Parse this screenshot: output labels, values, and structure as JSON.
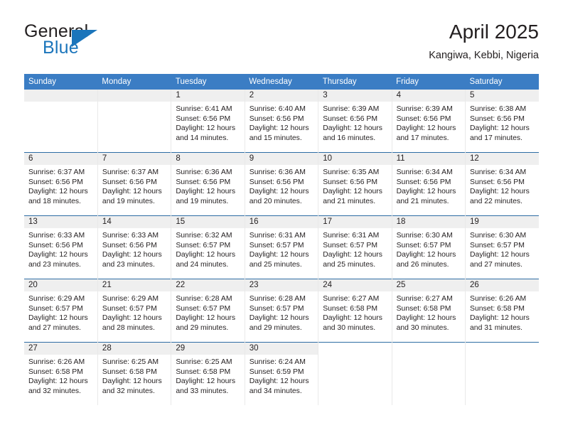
{
  "brand": {
    "name_part1": "General",
    "name_part2": "Blue",
    "logo_icon": "blue-triangle-icon"
  },
  "header": {
    "month_title": "April 2025",
    "location": "Kangiwa, Kebbi, Nigeria"
  },
  "colors": {
    "header_blue": "#3b7dc4",
    "row_divider_blue": "#2e6da4",
    "daynum_strip_grey": "#efefef",
    "brand_blue": "#1b75bb",
    "text": "#231f20"
  },
  "calendar": {
    "weekday_headers": [
      "Sunday",
      "Monday",
      "Tuesday",
      "Wednesday",
      "Thursday",
      "Friday",
      "Saturday"
    ],
    "weeks": [
      [
        {
          "day": "",
          "empty": true
        },
        {
          "day": "",
          "empty": true
        },
        {
          "day": "1",
          "sunrise": "Sunrise: 6:41 AM",
          "sunset": "Sunset: 6:56 PM",
          "daylight1": "Daylight: 12 hours",
          "daylight2": "and 14 minutes."
        },
        {
          "day": "2",
          "sunrise": "Sunrise: 6:40 AM",
          "sunset": "Sunset: 6:56 PM",
          "daylight1": "Daylight: 12 hours",
          "daylight2": "and 15 minutes."
        },
        {
          "day": "3",
          "sunrise": "Sunrise: 6:39 AM",
          "sunset": "Sunset: 6:56 PM",
          "daylight1": "Daylight: 12 hours",
          "daylight2": "and 16 minutes."
        },
        {
          "day": "4",
          "sunrise": "Sunrise: 6:39 AM",
          "sunset": "Sunset: 6:56 PM",
          "daylight1": "Daylight: 12 hours",
          "daylight2": "and 17 minutes."
        },
        {
          "day": "5",
          "sunrise": "Sunrise: 6:38 AM",
          "sunset": "Sunset: 6:56 PM",
          "daylight1": "Daylight: 12 hours",
          "daylight2": "and 17 minutes."
        }
      ],
      [
        {
          "day": "6",
          "sunrise": "Sunrise: 6:37 AM",
          "sunset": "Sunset: 6:56 PM",
          "daylight1": "Daylight: 12 hours",
          "daylight2": "and 18 minutes."
        },
        {
          "day": "7",
          "sunrise": "Sunrise: 6:37 AM",
          "sunset": "Sunset: 6:56 PM",
          "daylight1": "Daylight: 12 hours",
          "daylight2": "and 19 minutes."
        },
        {
          "day": "8",
          "sunrise": "Sunrise: 6:36 AM",
          "sunset": "Sunset: 6:56 PM",
          "daylight1": "Daylight: 12 hours",
          "daylight2": "and 19 minutes."
        },
        {
          "day": "9",
          "sunrise": "Sunrise: 6:36 AM",
          "sunset": "Sunset: 6:56 PM",
          "daylight1": "Daylight: 12 hours",
          "daylight2": "and 20 minutes."
        },
        {
          "day": "10",
          "sunrise": "Sunrise: 6:35 AM",
          "sunset": "Sunset: 6:56 PM",
          "daylight1": "Daylight: 12 hours",
          "daylight2": "and 21 minutes."
        },
        {
          "day": "11",
          "sunrise": "Sunrise: 6:34 AM",
          "sunset": "Sunset: 6:56 PM",
          "daylight1": "Daylight: 12 hours",
          "daylight2": "and 21 minutes."
        },
        {
          "day": "12",
          "sunrise": "Sunrise: 6:34 AM",
          "sunset": "Sunset: 6:56 PM",
          "daylight1": "Daylight: 12 hours",
          "daylight2": "and 22 minutes."
        }
      ],
      [
        {
          "day": "13",
          "sunrise": "Sunrise: 6:33 AM",
          "sunset": "Sunset: 6:56 PM",
          "daylight1": "Daylight: 12 hours",
          "daylight2": "and 23 minutes."
        },
        {
          "day": "14",
          "sunrise": "Sunrise: 6:33 AM",
          "sunset": "Sunset: 6:56 PM",
          "daylight1": "Daylight: 12 hours",
          "daylight2": "and 23 minutes."
        },
        {
          "day": "15",
          "sunrise": "Sunrise: 6:32 AM",
          "sunset": "Sunset: 6:57 PM",
          "daylight1": "Daylight: 12 hours",
          "daylight2": "and 24 minutes."
        },
        {
          "day": "16",
          "sunrise": "Sunrise: 6:31 AM",
          "sunset": "Sunset: 6:57 PM",
          "daylight1": "Daylight: 12 hours",
          "daylight2": "and 25 minutes."
        },
        {
          "day": "17",
          "sunrise": "Sunrise: 6:31 AM",
          "sunset": "Sunset: 6:57 PM",
          "daylight1": "Daylight: 12 hours",
          "daylight2": "and 25 minutes."
        },
        {
          "day": "18",
          "sunrise": "Sunrise: 6:30 AM",
          "sunset": "Sunset: 6:57 PM",
          "daylight1": "Daylight: 12 hours",
          "daylight2": "and 26 minutes."
        },
        {
          "day": "19",
          "sunrise": "Sunrise: 6:30 AM",
          "sunset": "Sunset: 6:57 PM",
          "daylight1": "Daylight: 12 hours",
          "daylight2": "and 27 minutes."
        }
      ],
      [
        {
          "day": "20",
          "sunrise": "Sunrise: 6:29 AM",
          "sunset": "Sunset: 6:57 PM",
          "daylight1": "Daylight: 12 hours",
          "daylight2": "and 27 minutes."
        },
        {
          "day": "21",
          "sunrise": "Sunrise: 6:29 AM",
          "sunset": "Sunset: 6:57 PM",
          "daylight1": "Daylight: 12 hours",
          "daylight2": "and 28 minutes."
        },
        {
          "day": "22",
          "sunrise": "Sunrise: 6:28 AM",
          "sunset": "Sunset: 6:57 PM",
          "daylight1": "Daylight: 12 hours",
          "daylight2": "and 29 minutes."
        },
        {
          "day": "23",
          "sunrise": "Sunrise: 6:28 AM",
          "sunset": "Sunset: 6:57 PM",
          "daylight1": "Daylight: 12 hours",
          "daylight2": "and 29 minutes."
        },
        {
          "day": "24",
          "sunrise": "Sunrise: 6:27 AM",
          "sunset": "Sunset: 6:58 PM",
          "daylight1": "Daylight: 12 hours",
          "daylight2": "and 30 minutes."
        },
        {
          "day": "25",
          "sunrise": "Sunrise: 6:27 AM",
          "sunset": "Sunset: 6:58 PM",
          "daylight1": "Daylight: 12 hours",
          "daylight2": "and 30 minutes."
        },
        {
          "day": "26",
          "sunrise": "Sunrise: 6:26 AM",
          "sunset": "Sunset: 6:58 PM",
          "daylight1": "Daylight: 12 hours",
          "daylight2": "and 31 minutes."
        }
      ],
      [
        {
          "day": "27",
          "sunrise": "Sunrise: 6:26 AM",
          "sunset": "Sunset: 6:58 PM",
          "daylight1": "Daylight: 12 hours",
          "daylight2": "and 32 minutes."
        },
        {
          "day": "28",
          "sunrise": "Sunrise: 6:25 AM",
          "sunset": "Sunset: 6:58 PM",
          "daylight1": "Daylight: 12 hours",
          "daylight2": "and 32 minutes."
        },
        {
          "day": "29",
          "sunrise": "Sunrise: 6:25 AM",
          "sunset": "Sunset: 6:58 PM",
          "daylight1": "Daylight: 12 hours",
          "daylight2": "and 33 minutes."
        },
        {
          "day": "30",
          "sunrise": "Sunrise: 6:24 AM",
          "sunset": "Sunset: 6:59 PM",
          "daylight1": "Daylight: 12 hours",
          "daylight2": "and 34 minutes."
        },
        {
          "day": "",
          "empty": true,
          "noStrip": true
        },
        {
          "day": "",
          "empty": true,
          "noStrip": true
        },
        {
          "day": "",
          "empty": true,
          "noStrip": true
        }
      ]
    ]
  }
}
